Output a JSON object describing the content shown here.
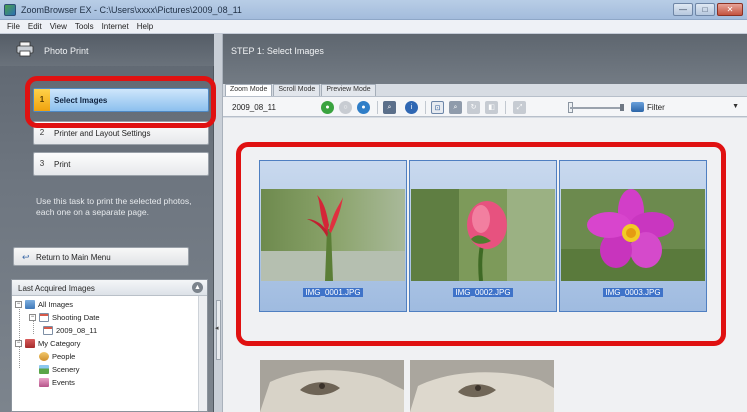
{
  "window": {
    "title": "ZoomBrowser EX - C:\\Users\\xxxx\\Pictures\\2009_08_11",
    "controls": [
      "—",
      "□",
      "✕"
    ]
  },
  "menu": [
    "File",
    "Edit",
    "View",
    "Tools",
    "Internet",
    "Help"
  ],
  "left_panel": {
    "header": "Photo Print",
    "steps": [
      {
        "num": "1",
        "label": "Select Images",
        "active": true
      },
      {
        "num": "2",
        "label": "Printer and Layout Settings",
        "active": false
      },
      {
        "num": "3",
        "label": "Print",
        "active": false
      }
    ],
    "description": "Use this task to print the selected photos, each one on a separate page.",
    "return_button": "Return to Main Menu",
    "tree": {
      "header": "Last Acquired Images",
      "nodes": [
        "All Images",
        "Shooting Date",
        "2009_08_11",
        "My Category",
        "People",
        "Scenery",
        "Events"
      ]
    }
  },
  "right_pane": {
    "step_title": "STEP 1: Select Images",
    "tabs": [
      "Zoom Mode",
      "Scroll Mode",
      "Preview Mode"
    ],
    "folder_label": "2009_08_11",
    "filter_label": "Filter",
    "thumbnails": [
      {
        "filename": "IMG_0001.JPG",
        "selected": true
      },
      {
        "filename": "IMG_0002.JPG",
        "selected": true
      },
      {
        "filename": "IMG_0003.JPG",
        "selected": true
      }
    ]
  },
  "colors": {
    "highlight": "#e01111",
    "selection": "#3f73c9",
    "active_step": "#8cc0ee"
  }
}
